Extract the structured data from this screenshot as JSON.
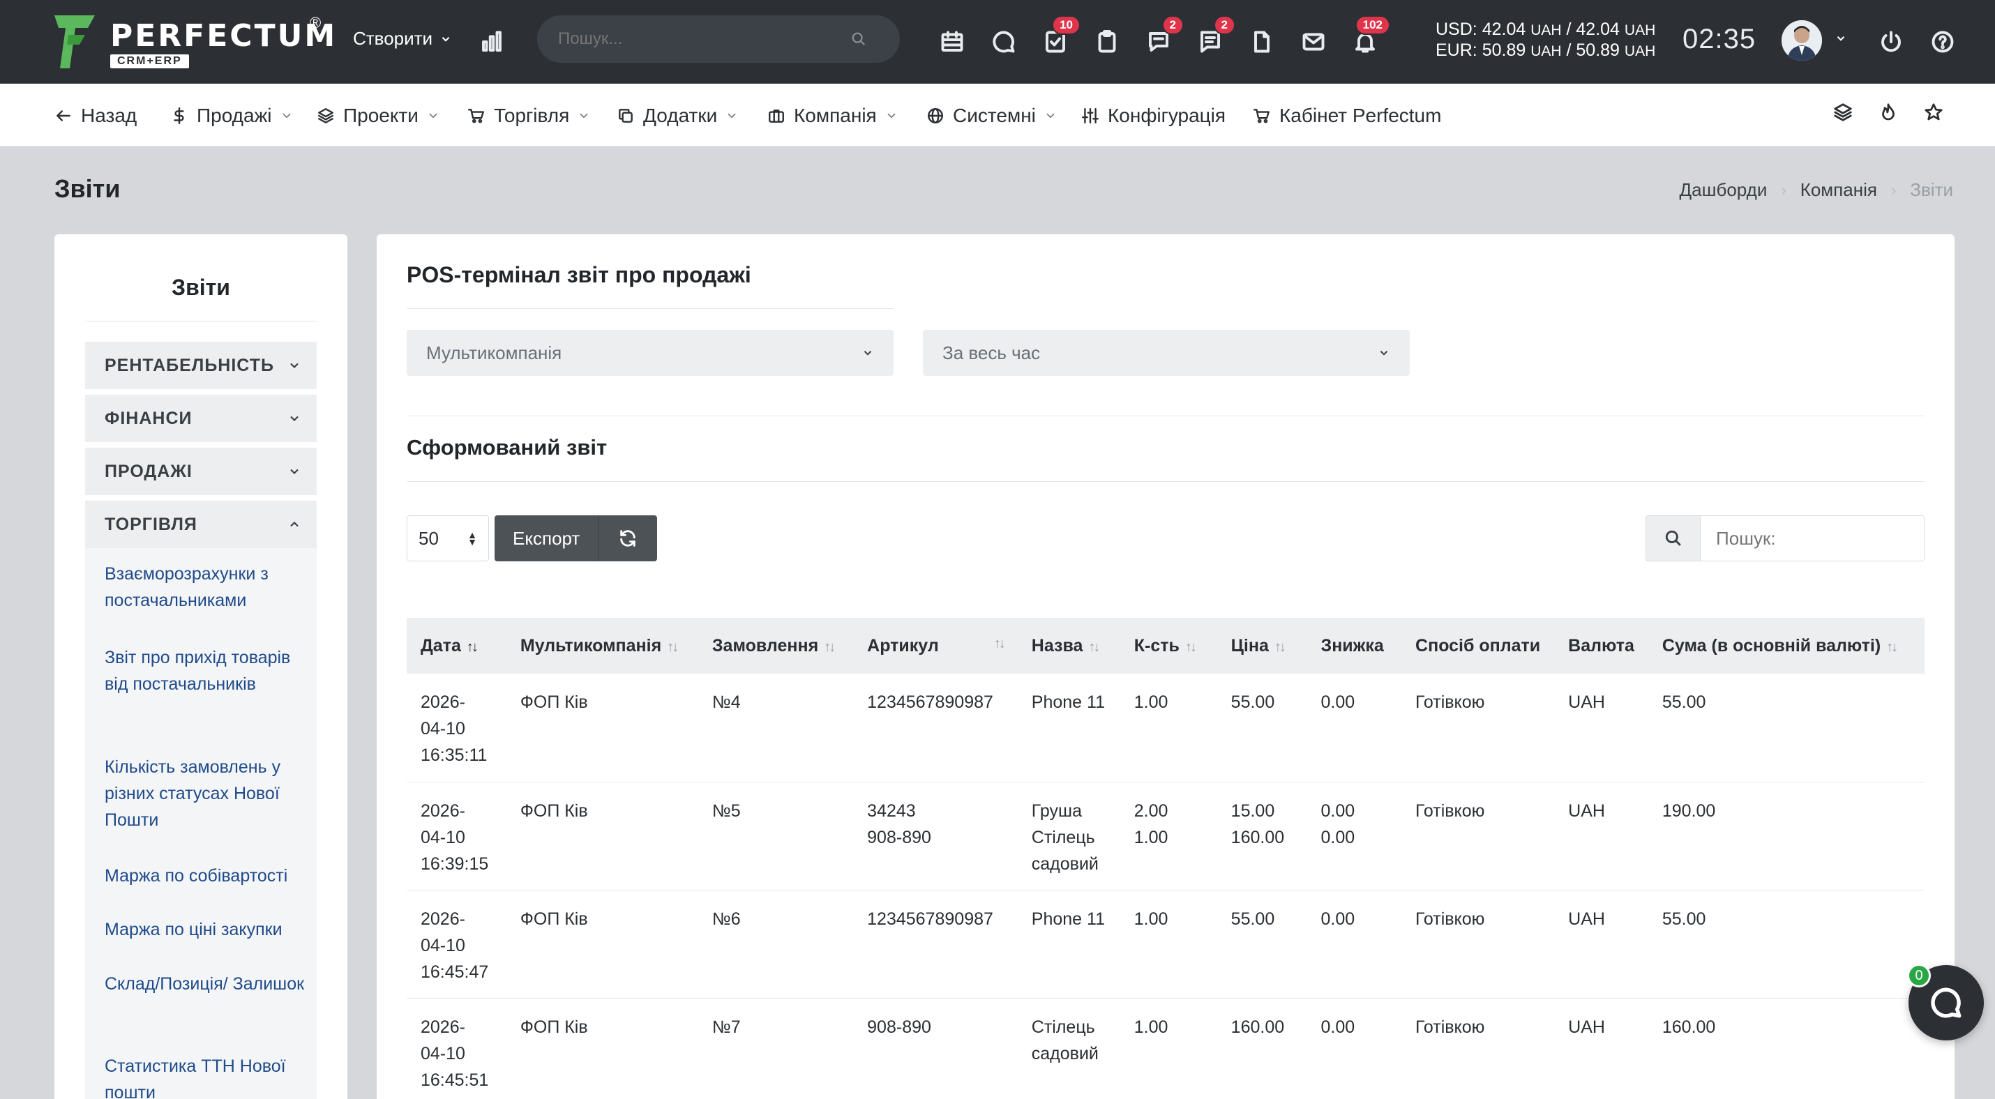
{
  "brand": {
    "name": "PERFECTUM",
    "registered": "®",
    "tagline": "CRM+ERP",
    "accent": "#5cb85c"
  },
  "topbar": {
    "create_label": "Створити",
    "search_placeholder": "Пошук...",
    "icons": [
      {
        "name": "stats-icon"
      },
      {
        "name": "calendar-icon"
      },
      {
        "name": "chat-icon"
      },
      {
        "name": "tasks-icon",
        "badge": "10"
      },
      {
        "name": "clipboard-icon"
      },
      {
        "name": "comments-icon",
        "badge": "2"
      },
      {
        "name": "messages-icon",
        "badge": "2"
      },
      {
        "name": "document-icon"
      },
      {
        "name": "mail-icon"
      },
      {
        "name": "bell-icon",
        "badge": "102"
      }
    ],
    "rates": {
      "usd_label": "USD:",
      "usd_buy": "42.04",
      "usd_sell": "42.04",
      "usd_cur": "UAH",
      "eur_label": "EUR:",
      "eur_buy": "50.89",
      "eur_sell": "50.89",
      "eur_cur": "UAH"
    },
    "clock": "02:35",
    "badge_color": "#e0344b"
  },
  "nav": {
    "back": "Назад",
    "items": [
      "Продажі",
      "Проекти",
      "Торгівля",
      "Додатки",
      "Компанія",
      "Системні",
      "Конфігурація",
      "Кабінет Perfectum"
    ]
  },
  "page": {
    "title": "Звіти"
  },
  "breadcrumbs": [
    "Дашборди",
    "Компанія",
    "Звіти"
  ],
  "sidebar": {
    "title": "Звіти",
    "sections": [
      "РЕНТАБЕЛЬНІСТЬ",
      "ФІНАНСИ",
      "ПРОДАЖІ",
      "ТОРГІВЛЯ"
    ],
    "links": [
      "Взаєморозрахунки з постачальниками",
      "Звіт про прихід товарів від постачальників",
      "Кількість замовлень у різних статусах Нової Пошти",
      "Маржа по собівартості",
      "Маржа по ціні закупки",
      "Склад/Позиція/ Залишок",
      "Статистика ТТН Нової пошти"
    ]
  },
  "report": {
    "title": "POS-термінал звіт про продажі",
    "filter_company": "Мультикомпанія",
    "filter_period": "За весь час",
    "generated_title": "Сформований звіт",
    "page_size": "50",
    "export_label": "Експорт",
    "search_placeholder": "Пошук:",
    "columns": [
      "Дата",
      "Мультикомпанія",
      "Замовлення",
      "Артикул",
      "Назва",
      "К-сть",
      "Ціна",
      "Знижка",
      "Спосіб оплати",
      "Валюта",
      "Сума (в основній валюті)"
    ],
    "rows": [
      {
        "date": "2026-04-10 16:35:11",
        "company": "ФОП Ків",
        "order": "№4",
        "sku": "1234567890987",
        "name": "Phone 11",
        "qty": "1.00",
        "price": "55.00",
        "discount": "0.00",
        "payment": "Готівкою",
        "currency": "UAH",
        "sum": "55.00"
      },
      {
        "date": "2026-04-10 16:39:15",
        "company": "ФОП Ків",
        "order": "№5",
        "sku": "34243\n908-890",
        "name": "Груша\nСтілець садовий",
        "qty": "2.00\n1.00",
        "price": "15.00\n160.00",
        "discount": "0.00\n0.00",
        "payment": "Готівкою",
        "currency": "UAH",
        "sum": "190.00"
      },
      {
        "date": "2026-04-10 16:45:47",
        "company": "ФОП Ків",
        "order": "№6",
        "sku": "1234567890987",
        "name": "Phone 11",
        "qty": "1.00",
        "price": "55.00",
        "discount": "0.00",
        "payment": "Готівкою",
        "currency": "UAH",
        "sum": "55.00"
      },
      {
        "date": "2026-04-10 16:45:51",
        "company": "ФОП Ків",
        "order": "№7",
        "sku": "908-890",
        "name": "Стілець садовий",
        "qty": "1.00",
        "price": "160.00",
        "discount": "0.00",
        "payment": "Готівкою",
        "currency": "UAH",
        "sum": "160.00"
      }
    ]
  },
  "chat": {
    "count": "0"
  }
}
